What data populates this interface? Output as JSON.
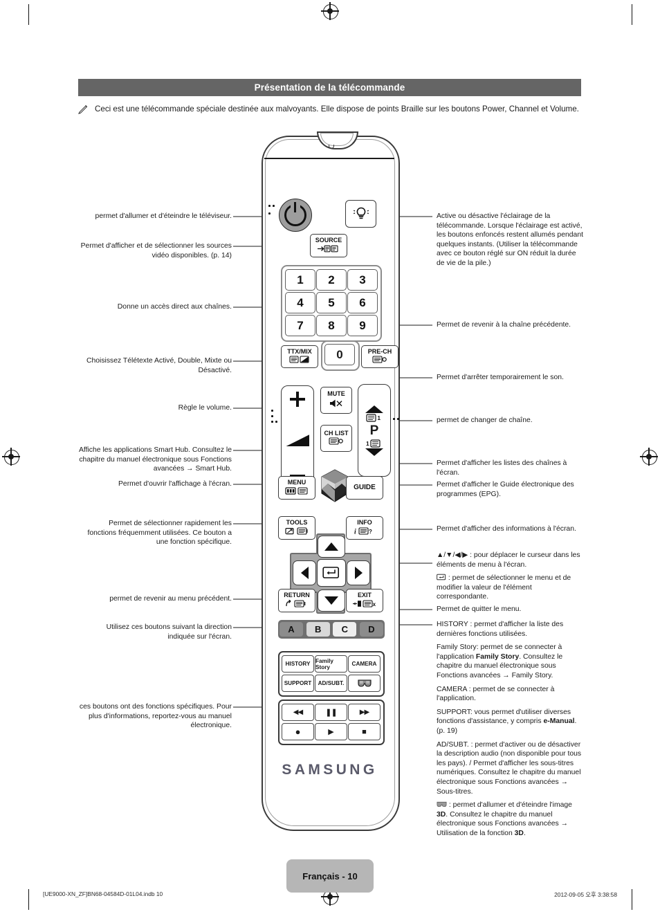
{
  "header": {
    "title": "Présentation de la télécommande"
  },
  "note": {
    "icon": "pencil-note-icon",
    "text": "Ceci est une télécommande spéciale destinée aux malvoyants. Elle dispose de points Braille sur les boutons Power, Channel et Volume."
  },
  "remote": {
    "brand": "SAMSUNG",
    "power_icon": "power-icon",
    "light_icon": "lightbulb-icon",
    "source": {
      "label": "SOURCE",
      "icon": "source-arrow-icon"
    },
    "numbers": [
      "1",
      "2",
      "3",
      "4",
      "5",
      "6",
      "7",
      "8",
      "9",
      "0"
    ],
    "ttx": {
      "label": "TTX/MIX",
      "icon": "teletext-icon"
    },
    "prech": {
      "label": "PRE-CH",
      "icon": "prech-icon"
    },
    "volume": {
      "plus": "+",
      "wedge": "volume-wedge-icon",
      "minus": "−"
    },
    "mute": {
      "label": "MUTE",
      "icon": "mute-speaker-icon"
    },
    "chlist": {
      "label": "CH LIST",
      "icon": "channel-list-icon"
    },
    "channel": {
      "up_icon": "chevron-up-icon",
      "label": "P",
      "down_icon": "chevron-down-icon"
    },
    "menu": {
      "label": "MENU",
      "icon": "menu-icon"
    },
    "guide": {
      "label": "GUIDE"
    },
    "smarthub": {
      "icon": "smart-hub-cube-icon"
    },
    "tools": {
      "label": "TOOLS",
      "icon": "tools-icon"
    },
    "info": {
      "label": "INFO",
      "icon": "info-icon"
    },
    "dpad": {
      "up_icon": "arrow-up-icon",
      "down_icon": "arrow-down-icon",
      "left_icon": "arrow-left-icon",
      "right_icon": "arrow-right-icon",
      "enter_icon": "enter-icon"
    },
    "return": {
      "label": "RETURN",
      "icon": "return-arrow-icon"
    },
    "exit": {
      "label": "EXIT",
      "icon": "exit-icon"
    },
    "color_buttons": [
      {
        "label": "A",
        "color": "#8c8c8c"
      },
      {
        "label": "B",
        "color": "#d8d8d8"
      },
      {
        "label": "C",
        "color": "#eeeeee"
      },
      {
        "label": "D",
        "color": "#8c8c8c"
      }
    ],
    "function_buttons": [
      {
        "label": "HISTORY"
      },
      {
        "label": "Family Story"
      },
      {
        "label": "CAMERA"
      },
      {
        "label": "SUPPORT"
      },
      {
        "label": "AD/SUBT."
      },
      {
        "label": "3d-glasses-icon"
      }
    ],
    "media_buttons": [
      {
        "name": "rewind-icon",
        "glyph": "◀◀"
      },
      {
        "name": "pause-icon",
        "glyph": "❚❚"
      },
      {
        "name": "fast-forward-icon",
        "glyph": "▶▶"
      },
      {
        "name": "record-icon",
        "glyph": "●"
      },
      {
        "name": "play-icon",
        "glyph": "▶"
      },
      {
        "name": "stop-icon",
        "glyph": "■"
      }
    ]
  },
  "annotations_left": [
    {
      "id": "power",
      "text": "permet d'allumer et d'éteindre le téléviseur."
    },
    {
      "id": "source",
      "text": "Permet d'afficher et de sélectionner les sources vidéo disponibles. (p. 14)"
    },
    {
      "id": "numbers",
      "text": "Donne un accès direct aux chaînes."
    },
    {
      "id": "ttx",
      "text": "Choisissez Télétexte Activé, Double, Mixte ou Désactivé."
    },
    {
      "id": "volume",
      "text": "Règle le volume."
    },
    {
      "id": "smart-hub",
      "text": "Affiche les applications Smart Hub. Consultez le chapitre du manuel électronique sous Fonctions avancées → Smart Hub."
    },
    {
      "id": "menu",
      "text": "Permet d'ouvrir l'affichage à l'écran."
    },
    {
      "id": "tools",
      "text": "Permet de sélectionner rapidement les fonctions fréquemment utilisées. Ce bouton a une fonction spécifique."
    },
    {
      "id": "return",
      "text": "permet de revenir au menu précédent."
    },
    {
      "id": "color",
      "text": "Utilisez ces boutons suivant la direction indiquée sur l'écran."
    },
    {
      "id": "media",
      "text": "ces boutons ont des fonctions spécifiques. Pour plus d'informations, reportez-vous au manuel électronique."
    }
  ],
  "annotations_right": {
    "light": "Active ou désactive l'éclairage de la télécommande. Lorsque l'éclairage est activé, les boutons enfoncés restent allumés pendant quelques instants. (Utiliser la télécommande avec ce bouton réglé sur ON réduit la durée de vie de la pile.)",
    "prech": "Permet de revenir à la chaîne précédente.",
    "mute": "Permet d'arrêter temporairement le son.",
    "channel": "permet de changer de chaîne.",
    "chlist": "Permet d'afficher les listes des chaînes à l'écran.",
    "guide": "Permet d'afficher le Guide électronique des programmes (EPG).",
    "info": "Permet d'afficher des informations à l'écran.",
    "dpad_move": " : pour déplacer le curseur dans les éléments de menu à l'écran.",
    "dpad_move_icons": "▲/▼/◀/▶",
    "dpad_enter": " : permet de sélectionner le menu et de modifier la valeur de l'élément correspondante.",
    "exit": "Permet de quitter le menu.",
    "history_label": "HISTORY",
    "history": " : permet d'afficher la liste des dernières fonctions utilisées.",
    "family_story_a": "Family Story: permet de se connecter à l'application ",
    "family_story_b": "Family Story",
    "family_story_c": ". Consultez le chapitre du manuel électronique sous Fonctions avancées → Family Story.",
    "camera": "CAMERA : permet de se connecter à l'application.",
    "support_a": "SUPPORT: vous permet d'utiliser diverses fonctions d'assistance, y compris ",
    "support_b": "e-Manual",
    "support_c": ". (p. 19)",
    "adsubt": "AD/SUBT. : permet d'activer ou de désactiver la description audio (non disponible pour tous les pays). / Permet d'afficher les sous-titres numériques. Consultez le chapitre du manuel électronique sous Fonctions avancées → Sous-titres.",
    "threed_a": " : permet d'allumer et d'éteindre l'image ",
    "threed_b": "3D",
    "threed_c": ". Consultez le chapitre du manuel électronique sous Fonctions avancées → Utilisation de la fonction ",
    "threed_d": "3D",
    "threed_e": "."
  },
  "footer": {
    "page_label": "Français - 10",
    "file_meta": "[UE9000-XN_ZF]BN68-04584D-01L04.indb   10",
    "date_meta": "2012-09-05   오후 3:38:58"
  }
}
